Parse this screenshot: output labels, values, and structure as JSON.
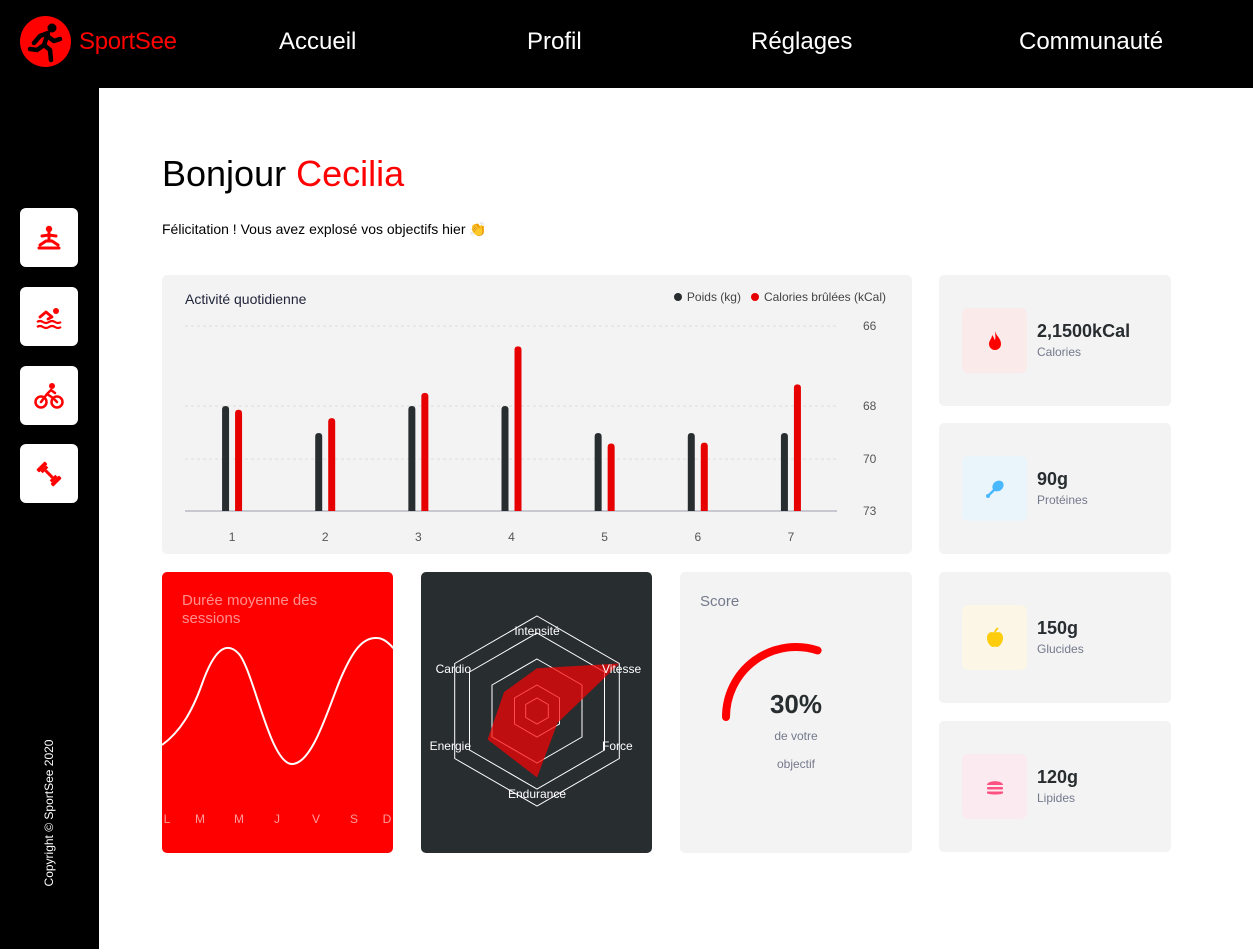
{
  "app": {
    "name": "SportSee"
  },
  "nav": {
    "items": [
      {
        "label": "Accueil"
      },
      {
        "label": "Profil"
      },
      {
        "label": "Réglages"
      },
      {
        "label": "Communauté"
      }
    ]
  },
  "sidebar": {
    "buttons": [
      {
        "icon": "meditation-icon"
      },
      {
        "icon": "swimming-icon"
      },
      {
        "icon": "cycling-icon"
      },
      {
        "icon": "dumbbell-icon"
      }
    ],
    "copyright": "Copyright © SportSee 2020"
  },
  "greeting": {
    "prefix": "Bonjour ",
    "name": "Cecilia"
  },
  "subtitle": "Félicitation ! Vous avez explosé vos objectifs hier 👏",
  "activity": {
    "title": "Activité quotidienne",
    "legend": {
      "weight": "Poids (kg)",
      "calories": "Calories brûlées (kCal)"
    },
    "colors": {
      "weight": "#282d30",
      "calories": "#e60000"
    }
  },
  "nutrition": [
    {
      "value": "2,1500kCal",
      "label": "Calories",
      "icon": "fire-icon",
      "bg": "#fbeaea",
      "color": "#ff0000"
    },
    {
      "value": "90g",
      "label": "Protéines",
      "icon": "chicken-icon",
      "bg": "#e9f4fb",
      "color": "#4ab8ff"
    },
    {
      "value": "150g",
      "label": "Glucides",
      "icon": "apple-icon",
      "bg": "#fbf6e5",
      "color": "#fdcc0c"
    },
    {
      "value": "120g",
      "label": "Lipides",
      "icon": "burger-icon",
      "bg": "#fbeaef",
      "color": "#fd5181"
    }
  ],
  "sessions": {
    "title": "Durée moyenne des sessions"
  },
  "score": {
    "title": "Score",
    "percent": "30%",
    "line1": "de votre",
    "line2": "objectif"
  },
  "chart_data": [
    {
      "type": "bar",
      "categories": [
        "1",
        "2",
        "3",
        "4",
        "5",
        "6",
        "7"
      ],
      "series": [
        {
          "name": "Poids (kg)",
          "values": [
            70,
            69,
            70,
            70,
            69,
            69,
            69
          ]
        },
        {
          "name": "Calories brûlées (kCal)",
          "values": [
            240,
            220,
            280,
            390,
            160,
            162,
            300
          ]
        }
      ],
      "title": "Activité quotidienne",
      "yticks": [
        "66",
        "68",
        "70",
        "73"
      ],
      "legend": "top-right"
    },
    {
      "type": "line",
      "categories": [
        "L",
        "M",
        "M",
        "J",
        "V",
        "S",
        "D"
      ],
      "values": [
        30,
        23,
        45,
        50,
        0,
        0,
        60
      ],
      "title": "Durée moyenne des sessions"
    },
    {
      "type": "radar",
      "categories": [
        "Intensité",
        "Vitesse",
        "Force",
        "Endurance",
        "Energie",
        "Cardio"
      ],
      "values": [
        90,
        200,
        50,
        140,
        120,
        80
      ]
    },
    {
      "type": "radial",
      "title": "Score",
      "value": 0.3
    }
  ]
}
